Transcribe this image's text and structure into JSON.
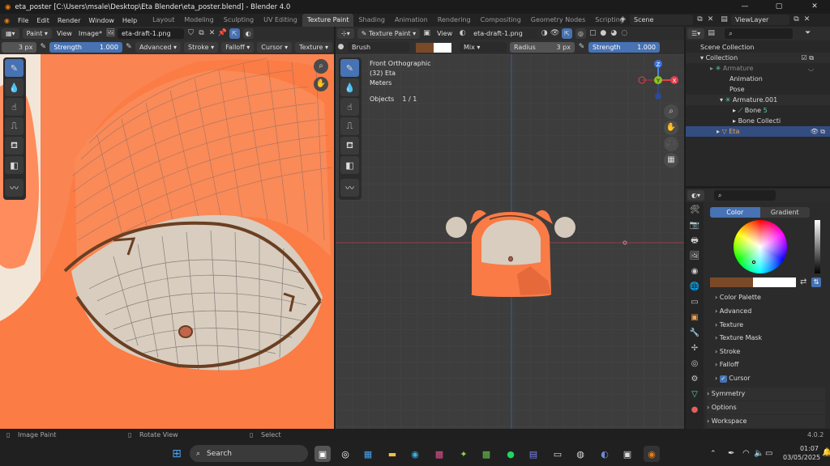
{
  "title": {
    "text": "eta_poster [C:\\Users\\msale\\Desktop\\Eta Blender\\eta_poster.blend] - Blender 4.0",
    "minimize": "—",
    "maximize": "▢",
    "close": "✕"
  },
  "menu": {
    "items": [
      "File",
      "Edit",
      "Render",
      "Window",
      "Help"
    ]
  },
  "workspaces": {
    "tabs": [
      "Layout",
      "Modeling",
      "Sculpting",
      "UV Editing",
      "Texture Paint",
      "Shading",
      "Animation",
      "Rendering",
      "Compositing",
      "Geometry Nodes",
      "Scripting"
    ],
    "active": "Texture Paint",
    "add": "+"
  },
  "scene": {
    "label": "Scene",
    "viewlayer": "ViewLayer"
  },
  "image_editor": {
    "mode": "Paint",
    "view": "View",
    "image_menu": "Image*",
    "image_name": "eta-draft-1.png",
    "radius": "3 px",
    "strength_label": "Strength",
    "strength_value": "1.000",
    "advanced": "Advanced",
    "stroke": "Stroke",
    "falloff": "Falloff",
    "cursor": "Cursor",
    "texture": "Texture"
  },
  "viewport": {
    "mode": "Texture Paint",
    "view": "View",
    "image_name": "eta-draft-1.png",
    "brush_label": "Brush",
    "blend": "Mix",
    "radius_label": "Radius",
    "radius_value": "3 px",
    "strength_label": "Strength",
    "strength_value": "1.000",
    "overlay_view": "Front Orthographic",
    "overlay_object": "(32) Eta",
    "overlay_units": "Meters",
    "objects_label": "Objects",
    "objects_value": "1 / 1",
    "brush_color": "#7a4a28"
  },
  "gizmo": {
    "z": "Z",
    "y": "Y",
    "x": "X"
  },
  "outliner": {
    "rows": [
      {
        "label": "Scene Collection",
        "indent": 0
      },
      {
        "label": "Collection",
        "indent": 1
      },
      {
        "label": "Armature",
        "indent": 2
      },
      {
        "label": "Animation",
        "indent": 3
      },
      {
        "label": "Pose",
        "indent": 3
      },
      {
        "label": "Armature.001",
        "indent": 2
      },
      {
        "label": "Bone",
        "indent": 3
      },
      {
        "label": "Bone Collecti",
        "indent": 3
      },
      {
        "label": "Eta",
        "indent": 2
      }
    ],
    "bone_count": "5"
  },
  "properties": {
    "color_tab": "Color",
    "gradient_tab": "Gradient",
    "sections": [
      "Color Palette",
      "Advanced",
      "Texture",
      "Texture Mask",
      "Stroke",
      "Falloff",
      "Cursor"
    ],
    "outer_sections": [
      "Symmetry",
      "Options",
      "Workspace"
    ],
    "version": "4.0.2"
  },
  "status": {
    "left": "Image Paint",
    "middle": "Rotate View",
    "right": "Select"
  },
  "taskbar": {
    "search_placeholder": "Search",
    "time": "01:07",
    "date": "03/05/2025"
  }
}
